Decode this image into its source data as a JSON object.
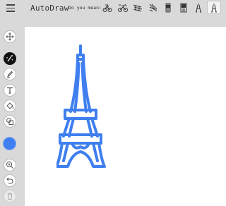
{
  "app": {
    "title": "AutoDraw"
  },
  "suggestions": {
    "label": "Do you mean:",
    "items": [
      {
        "name": "bicycle-sketch-icon"
      },
      {
        "name": "bicycle-sketch-2-icon"
      },
      {
        "name": "bicycle-sketch-3-icon"
      },
      {
        "name": "windmill-sketch-icon"
      },
      {
        "name": "phone-sketch-icon"
      },
      {
        "name": "tower-clock-sketch-icon"
      },
      {
        "name": "eiffel-tower-small-icon"
      },
      {
        "name": "eiffel-tower-selected-icon",
        "selected": true
      }
    ]
  },
  "tools": [
    {
      "name": "move-tool-button",
      "icon": "move-arrows-icon"
    },
    {
      "name": "autodraw-tool-button",
      "icon": "autodraw-wand-icon",
      "active": true
    },
    {
      "name": "draw-tool-button",
      "icon": "pencil-icon"
    },
    {
      "name": "type-tool-button",
      "icon": "text-t-icon"
    },
    {
      "name": "fill-tool-button",
      "icon": "paint-bucket-icon"
    },
    {
      "name": "shape-tool-button",
      "icon": "shapes-icon"
    },
    {
      "name": "zoom-tool-button",
      "icon": "zoom-in-icon"
    },
    {
      "name": "undo-button",
      "icon": "undo-icon"
    },
    {
      "name": "delete-button",
      "icon": "trash-icon",
      "disabled": true
    }
  ],
  "colors": {
    "accent": "#3f7ff0",
    "stroke": "#3f7ff0",
    "toolbar_bg": "#d9d9d9"
  }
}
